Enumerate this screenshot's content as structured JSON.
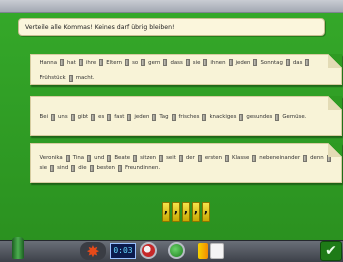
{
  "instruction": "Verteile alle Kommas! Keines darf übrig bleiben!",
  "sentences": [
    {
      "words": [
        "Hanna",
        "hat",
        "ihre",
        "Eltern",
        "so",
        "gern",
        "dass",
        "sie",
        "ihnen",
        "jeden",
        "Sonntag",
        "das",
        "Frühstück",
        "macht."
      ]
    },
    {
      "words": [
        "Bei",
        "uns",
        "gibt",
        "es",
        "fast",
        "jeden",
        "Tag",
        "frisches",
        "knackiges",
        "gesundes",
        "Gemüse."
      ]
    },
    {
      "words": [
        "Veronika",
        "Tina",
        "und",
        "Beate",
        "sitzen",
        "seit",
        "der",
        "ersten",
        "Klasse",
        "nebeneinander",
        "denn",
        "sie",
        "sind",
        "die",
        "besten",
        "Freundinnen."
      ]
    }
  ],
  "comma_tray": {
    "count": 5,
    "glyph": ","
  },
  "toolbar": {
    "score_display": "0:03"
  },
  "colors": {
    "background": "#2e9a22",
    "paper": "#f8f3d7",
    "comma_tile": "#f5e34a"
  }
}
